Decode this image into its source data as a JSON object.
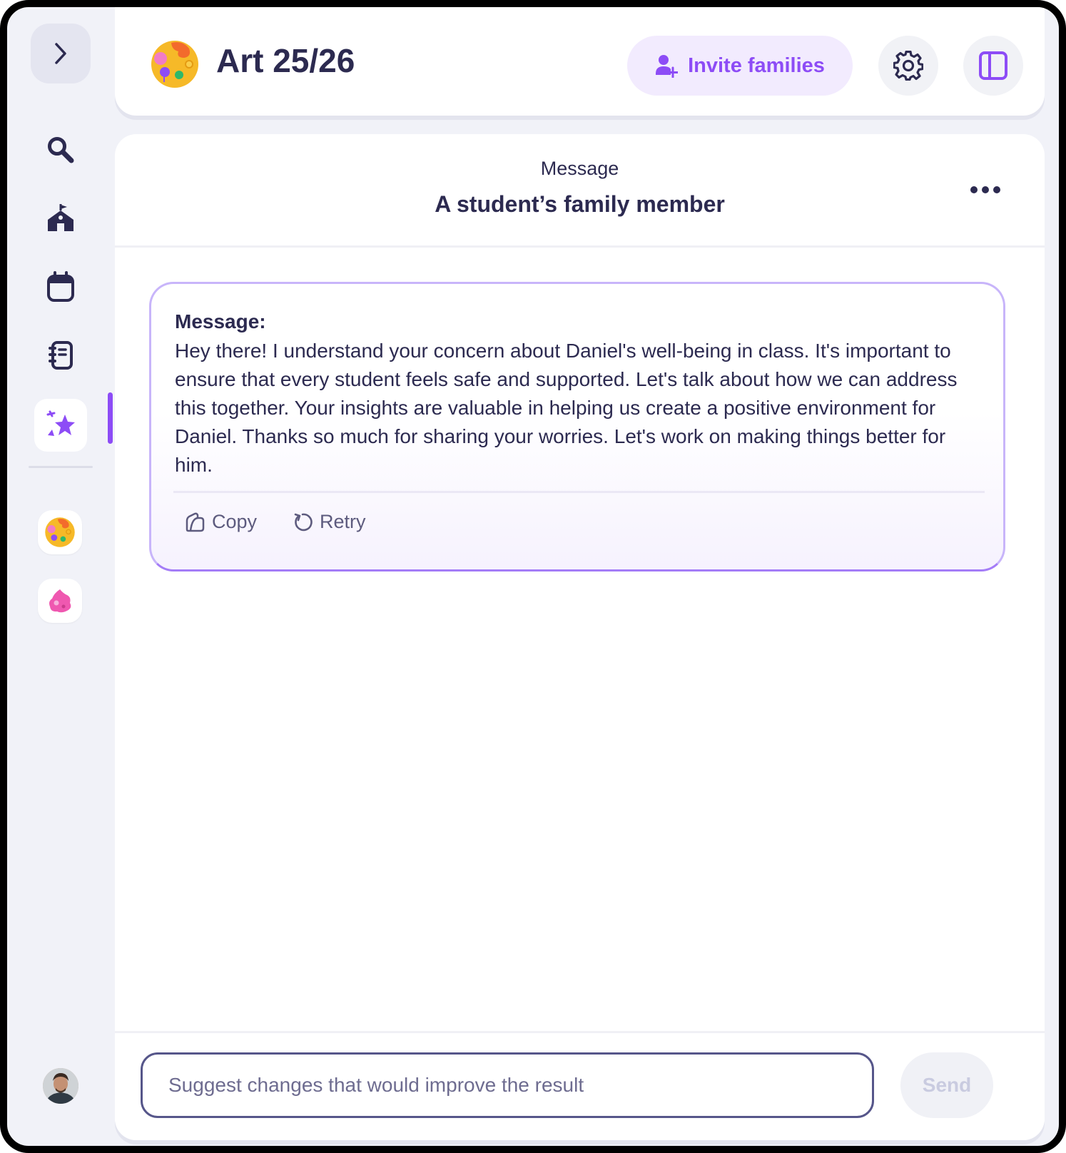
{
  "sidebar": {
    "icons": [
      "chevron-right-icon",
      "search-icon",
      "school-icon",
      "calendar-icon",
      "notebook-icon",
      "sparkles-icon"
    ],
    "accent": "#8d4cf6"
  },
  "header": {
    "class_title": "Art 25/26",
    "invite_label": "Invite families",
    "accent": "#8d4cf6"
  },
  "panel": {
    "kicker": "Message",
    "title": "A student’s family member"
  },
  "card": {
    "label": "Message:",
    "body": "Hey there! I understand your concern about Daniel's well-being in class. It's important to ensure that every student feels safe and supported. Let's talk about how we can address this together. Your insights are valuable in helping us create a positive environment for Daniel. Thanks so much for sharing your worries. Let's work on making things better for him.",
    "copy_label": "Copy",
    "retry_label": "Retry"
  },
  "composer": {
    "placeholder": "Suggest changes that would improve the result",
    "value": "",
    "send_label": "Send"
  }
}
